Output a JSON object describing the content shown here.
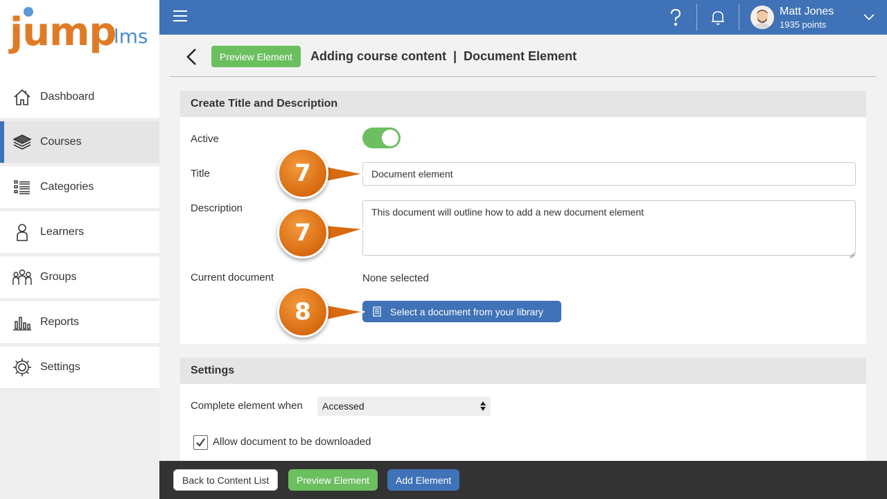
{
  "logo": {
    "main": "jump",
    "suffix": "lms"
  },
  "sidebar": {
    "items": [
      {
        "label": "Dashboard",
        "icon": "home-icon"
      },
      {
        "label": "Courses",
        "icon": "layers-icon",
        "active": true
      },
      {
        "label": "Categories",
        "icon": "list-icon"
      },
      {
        "label": "Learners",
        "icon": "person-icon"
      },
      {
        "label": "Groups",
        "icon": "group-icon"
      },
      {
        "label": "Reports",
        "icon": "bar-chart-icon"
      },
      {
        "label": "Settings",
        "icon": "gear-icon"
      }
    ]
  },
  "topbar": {
    "user_name": "Matt Jones",
    "user_points": "1935 points"
  },
  "header": {
    "preview_label": "Preview Element",
    "title": "Adding course content  |  Document Element"
  },
  "card_title": {
    "heading": "Create Title and Description",
    "active_label": "Active",
    "active_on": true,
    "title_label": "Title",
    "title_value": "Document element",
    "description_label": "Description",
    "description_value": "This document will outline how to add a new document element",
    "current_doc_label": "Current document",
    "current_doc_value": "None selected",
    "select_doc_button": "Select a document from your library"
  },
  "card_settings": {
    "heading": "Settings",
    "complete_label": "Complete element when",
    "complete_value": "Accessed",
    "download_label": "Allow document to be downloaded",
    "download_checked": true
  },
  "callouts": [
    "7",
    "7",
    "8"
  ],
  "bottombar": {
    "back_label": "Back to Content List",
    "preview_label": "Preview Element",
    "add_label": "Add Element"
  },
  "colors": {
    "primary": "#3f72b7",
    "success": "#6bbf5f",
    "callout": "#e07b25",
    "bottombar": "#333333"
  }
}
